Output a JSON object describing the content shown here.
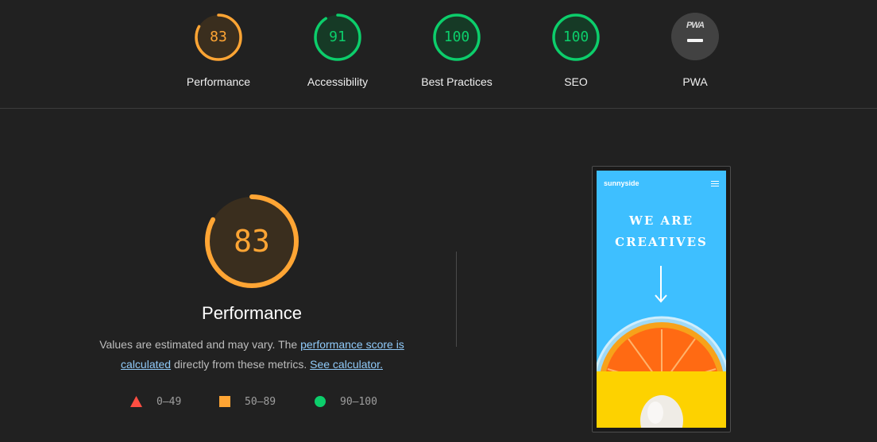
{
  "categories": [
    {
      "name": "Performance",
      "score": "83",
      "value": 83,
      "color": "#ffa534",
      "bg": "#3a2e1e"
    },
    {
      "name": "Accessibility",
      "score": "91",
      "value": 91,
      "color": "#0cce6b",
      "bg": "#163a26"
    },
    {
      "name": "Best Practices",
      "score": "100",
      "value": 100,
      "color": "#0cce6b",
      "bg": "#163a26"
    },
    {
      "name": "SEO",
      "score": "100",
      "value": 100,
      "color": "#0cce6b",
      "bg": "#163a26"
    },
    {
      "name": "PWA",
      "badge": "PWA",
      "color": "#9e9e9e",
      "bg": "#424242"
    }
  ],
  "performance": {
    "score": "83",
    "value": 83,
    "title": "Performance",
    "desc_prefix": "Values are estimated and may vary. The ",
    "link_score": "performance score is calculated",
    "desc_middle": " directly from these metrics. ",
    "link_calc": "See calculator."
  },
  "legend": [
    {
      "shape": "triangle",
      "color": "#ff4e42",
      "range": "0–49"
    },
    {
      "shape": "square",
      "color": "#ffa534",
      "range": "50–89"
    },
    {
      "shape": "circle",
      "color": "#0cce6b",
      "range": "90–100"
    }
  ],
  "screenshot": {
    "brand": "sunnyside",
    "hero_line1": "WE ARE",
    "hero_line2": "CREATIVES",
    "icons": [
      "menu-icon",
      "arrow-down-icon"
    ]
  }
}
